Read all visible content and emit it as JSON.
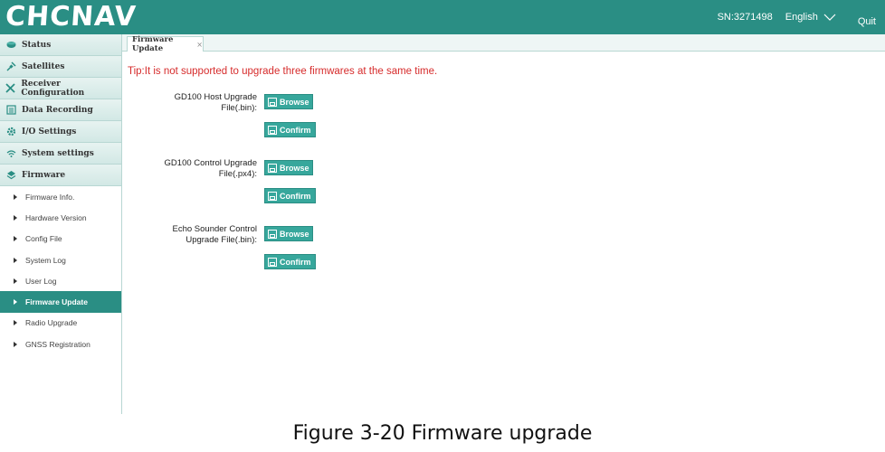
{
  "header": {
    "logo": "CHCNAV",
    "sn": "SN:3271498",
    "language": "English",
    "quit": "Quit",
    "color": "#2a8e84"
  },
  "sidebar": {
    "sections": [
      {
        "label": "Status",
        "icon": "status-icon"
      },
      {
        "label": "Satellites",
        "icon": "satellite-icon"
      },
      {
        "label": "Receiver Configuration",
        "icon": "tools-icon"
      },
      {
        "label": "Data Recording",
        "icon": "document-icon"
      },
      {
        "label": "I/O Settings",
        "icon": "gear-icon"
      },
      {
        "label": "System settings",
        "icon": "wifi-icon"
      },
      {
        "label": "Firmware",
        "icon": "layers-icon"
      }
    ],
    "firmware_items": [
      "Firmware Info.",
      "Hardware Version",
      "Config File",
      "System Log",
      "User Log",
      "Firmware Update",
      "Radio Upgrade",
      "GNSS Registration"
    ],
    "active_item": "Firmware Update"
  },
  "tab": {
    "label": "Firmware Update",
    "close": "×"
  },
  "main": {
    "tip": "Tip:It is not supported to upgrade three firmwares at the same time.",
    "uploads": [
      {
        "label_line1": "GD100 Host Upgrade",
        "label_line2": "File(.bin):"
      },
      {
        "label_line1": "GD100 Control Upgrade",
        "label_line2": "File(.px4):"
      },
      {
        "label_line1": "Echo Sounder Control",
        "label_line2": "Upgrade File(.bin):"
      }
    ],
    "browse_label": "Browse",
    "confirm_label": "Confirm"
  },
  "caption": "Figure 3-20 Firmware upgrade"
}
